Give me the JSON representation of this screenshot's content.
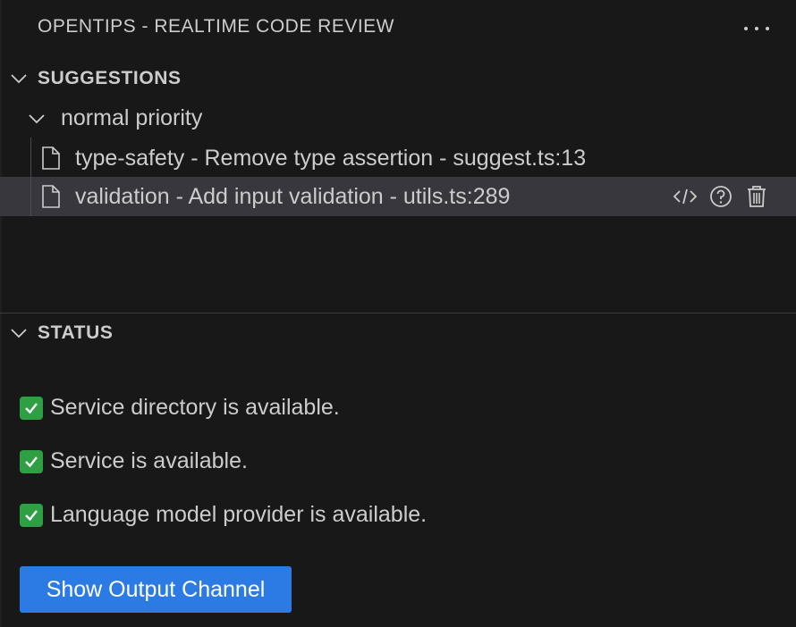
{
  "header": {
    "title": "OPENTIPS - REALTIME CODE REVIEW",
    "more_icon": "ellipsis-icon"
  },
  "suggestions": {
    "section_label": "SUGGESTIONS",
    "group_label": "normal priority",
    "items": [
      {
        "label": "type-safety - Remove type assertion - suggest.ts:13",
        "icon": "file-icon"
      },
      {
        "label": "validation - Add input validation - utils.ts:289",
        "icon": "file-icon",
        "selected": true,
        "actions": [
          "code-icon",
          "help-icon",
          "trash-icon"
        ]
      }
    ]
  },
  "status": {
    "section_label": "STATUS",
    "lines": [
      "Service directory is available.",
      "Service is available.",
      "Language model provider is available."
    ],
    "button_label": "Show Output Channel"
  },
  "colors": {
    "background": "#181818",
    "button": "#2c7be5",
    "selection": "#37373d",
    "check": "#2ea043"
  }
}
